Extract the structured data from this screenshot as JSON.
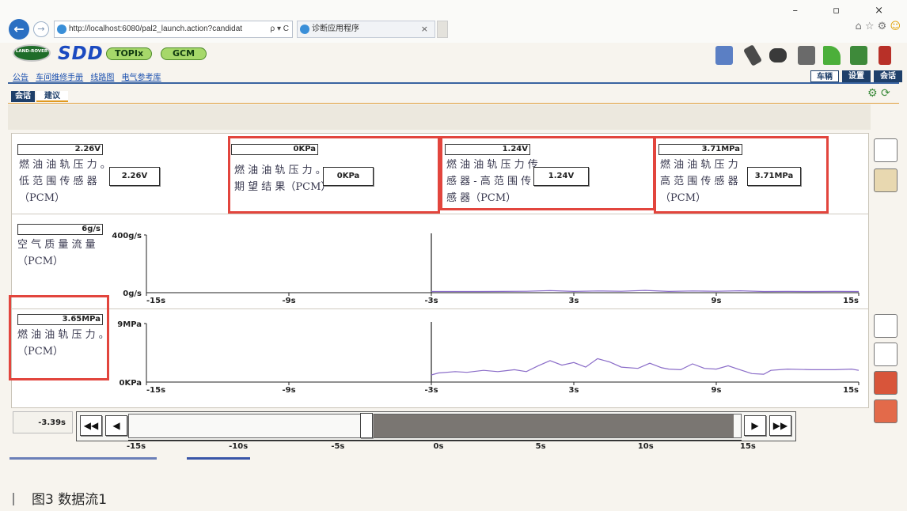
{
  "browser": {
    "url": "http://localhost:6080/pal2_launch.action?candidat",
    "url_tools": "ρ ▾ C",
    "tab_title": "诊断应用程序",
    "tab_close": "×",
    "window_controls": "–  ▫  ×"
  },
  "header": {
    "logo_text": "LAND-ROVER",
    "app_name": "SDD",
    "pill_topix": "TOPIx",
    "pill_gcm": "GCM",
    "links": [
      "公告",
      "车间维修手册",
      "线路图",
      "电气参考库"
    ],
    "right_tabs": [
      "车辆",
      "设置",
      "会话"
    ],
    "sub_tabs": [
      "会话",
      "建议"
    ]
  },
  "toolbar_icons": [
    "network-icon",
    "wrench-icon",
    "battery-icon",
    "book-icon",
    "signal-icon",
    "person-connect-icon",
    "exit-icon"
  ],
  "cells": [
    {
      "title": "燃 油 油 轨 压 力 。\n低 范 围 传 感 器\n（PCM）",
      "top_value": "2.26V",
      "box_value": "2.26V"
    },
    {
      "title": "燃 油 油 轨 压 力 。\n期 望 结 果（PCM）",
      "top_value": "0KPa",
      "box_value": "0KPa"
    },
    {
      "title": "燃 油 油 轨 压 力 传\n感 器 - 高 范 围 传\n感 器（PCM）",
      "top_value": "1.24V",
      "box_value": "1.24V"
    },
    {
      "title": "燃 油 油 轨 压 力\n高 范 围 传 感 器\n（PCM）",
      "top_value": "3.71MPa",
      "box_value": "3.71MPa"
    }
  ],
  "chart_data": [
    {
      "type": "line",
      "title": "空 气 质 量 流 量\n（PCM）",
      "current_value": "6g/s",
      "y_top_label": "400g/s",
      "y_bottom_label": "0g/s",
      "ylim": [
        0,
        400
      ],
      "xlim": [
        -15,
        15
      ],
      "tick_labels": [
        "-15s",
        "-9s",
        "-3s",
        "3s",
        "9s",
        "15s"
      ],
      "tick_positions": [
        -15,
        -9,
        -3,
        3,
        9,
        15
      ],
      "cursor_x": -3,
      "series": [
        {
          "values": [
            [
              -3,
              8
            ],
            [
              -1,
              8
            ],
            [
              1,
              10
            ],
            [
              2,
              14
            ],
            [
              3,
              9
            ],
            [
              4,
              12
            ],
            [
              5,
              10
            ],
            [
              6,
              16
            ],
            [
              7,
              9
            ],
            [
              8,
              12
            ],
            [
              9,
              10
            ],
            [
              10,
              13
            ],
            [
              11,
              8
            ],
            [
              12,
              9
            ],
            [
              13,
              8
            ],
            [
              14,
              9
            ],
            [
              15,
              8
            ]
          ]
        }
      ]
    },
    {
      "type": "line",
      "title": "燃 油 油 轨 压 力 。\n（PCM）",
      "current_value": "3.65MPa",
      "y_top_label": "9MPa",
      "y_bottom_label": "0KPa",
      "ylim": [
        0,
        9
      ],
      "xlim": [
        -15,
        15
      ],
      "tick_labels": [
        "-15s",
        "-9s",
        "-3s",
        "3s",
        "9s",
        "15s"
      ],
      "tick_positions": [
        -15,
        -9,
        -3,
        3,
        9,
        15
      ],
      "cursor_x": -3,
      "series": [
        {
          "values": [
            [
              -3,
              1.1
            ],
            [
              -2.7,
              1.4
            ],
            [
              -2,
              1.6
            ],
            [
              -1.5,
              1.5
            ],
            [
              -0.8,
              1.8
            ],
            [
              -0.2,
              1.6
            ],
            [
              0.5,
              1.9
            ],
            [
              1,
              1.6
            ],
            [
              1.5,
              2.5
            ],
            [
              2,
              3.3
            ],
            [
              2.5,
              2.6
            ],
            [
              3,
              3.0
            ],
            [
              3.5,
              2.3
            ],
            [
              4,
              3.6
            ],
            [
              4.5,
              3.1
            ],
            [
              5,
              2.3
            ],
            [
              5.7,
              2.1
            ],
            [
              6.2,
              2.9
            ],
            [
              6.7,
              2.2
            ],
            [
              7,
              2.0
            ],
            [
              7.5,
              1.9
            ],
            [
              8,
              2.8
            ],
            [
              8.5,
              2.1
            ],
            [
              9,
              2.0
            ],
            [
              9.5,
              2.5
            ],
            [
              10,
              1.9
            ],
            [
              10.5,
              1.3
            ],
            [
              11,
              1.2
            ],
            [
              11.3,
              1.8
            ],
            [
              12,
              2.0
            ],
            [
              13,
              1.9
            ],
            [
              14,
              1.9
            ],
            [
              14.7,
              2.0
            ],
            [
              15,
              1.8
            ]
          ]
        }
      ]
    }
  ],
  "side_icons": [
    "list-icon",
    "save-icon",
    "zoom-in-icon",
    "zoom-out-icon",
    "chart-icon",
    "record-icon"
  ],
  "timeline": {
    "current_time": "-3.39s",
    "btn_rewind": "◀◀",
    "btn_back": "◀",
    "btn_fwd": "▶",
    "btn_ffwd": "▶▶",
    "tick_labels": [
      "-15s",
      "-10s",
      "-5s",
      "0s",
      "5s",
      "10s",
      "15s"
    ]
  },
  "caption": "图3   数据流1"
}
